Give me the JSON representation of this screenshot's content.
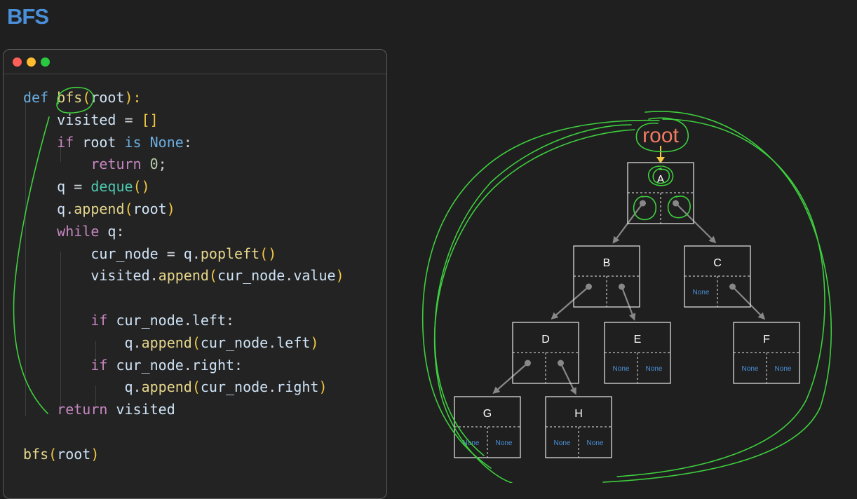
{
  "page": {
    "title": "BFS"
  },
  "code": {
    "lines": [
      [
        {
          "t": "def ",
          "c": "kw"
        },
        {
          "t": "bfs",
          "c": "fn"
        },
        {
          "t": "(",
          "c": "par"
        },
        {
          "t": "root",
          "c": "var"
        },
        {
          "t": "):",
          "c": "par"
        }
      ],
      [
        {
          "t": "    "
        },
        {
          "t": "visited",
          "c": "var"
        },
        {
          "t": " = "
        },
        {
          "t": "[]",
          "c": "par"
        }
      ],
      [
        {
          "t": "    "
        },
        {
          "t": "if ",
          "c": "kw2"
        },
        {
          "t": "root",
          "c": "var"
        },
        {
          "t": " is ",
          "c": "kw"
        },
        {
          "t": "None",
          "c": "kw"
        },
        {
          "t": ":"
        }
      ],
      [
        {
          "t": "        "
        },
        {
          "t": "return ",
          "c": "kw2"
        },
        {
          "t": "0",
          "c": "num"
        },
        {
          "t": ";"
        }
      ],
      [
        {
          "t": "    "
        },
        {
          "t": "q",
          "c": "var"
        },
        {
          "t": " = "
        },
        {
          "t": "deque",
          "c": "cls"
        },
        {
          "t": "()",
          "c": "par"
        }
      ],
      [
        {
          "t": "    "
        },
        {
          "t": "q",
          "c": "var"
        },
        {
          "t": "."
        },
        {
          "t": "append",
          "c": "fn"
        },
        {
          "t": "(",
          "c": "par"
        },
        {
          "t": "root",
          "c": "var"
        },
        {
          "t": ")",
          "c": "par"
        }
      ],
      [
        {
          "t": "    "
        },
        {
          "t": "while ",
          "c": "kw2"
        },
        {
          "t": "q",
          "c": "var"
        },
        {
          "t": ":"
        }
      ],
      [
        {
          "t": "        "
        },
        {
          "t": "cur_node",
          "c": "var"
        },
        {
          "t": " = "
        },
        {
          "t": "q",
          "c": "var"
        },
        {
          "t": "."
        },
        {
          "t": "popleft",
          "c": "fn"
        },
        {
          "t": "()",
          "c": "par"
        }
      ],
      [
        {
          "t": "        "
        },
        {
          "t": "visited",
          "c": "var"
        },
        {
          "t": "."
        },
        {
          "t": "append",
          "c": "fn"
        },
        {
          "t": "(",
          "c": "par"
        },
        {
          "t": "cur_node",
          "c": "var"
        },
        {
          "t": "."
        },
        {
          "t": "value",
          "c": "var"
        },
        {
          "t": ")",
          "c": "par"
        }
      ],
      [],
      [
        {
          "t": "        "
        },
        {
          "t": "if ",
          "c": "kw2"
        },
        {
          "t": "cur_node",
          "c": "var"
        },
        {
          "t": "."
        },
        {
          "t": "left",
          "c": "var"
        },
        {
          "t": ":"
        }
      ],
      [
        {
          "t": "            "
        },
        {
          "t": "q",
          "c": "var"
        },
        {
          "t": "."
        },
        {
          "t": "append",
          "c": "fn"
        },
        {
          "t": "(",
          "c": "par"
        },
        {
          "t": "cur_node",
          "c": "var"
        },
        {
          "t": "."
        },
        {
          "t": "left",
          "c": "var"
        },
        {
          "t": ")",
          "c": "par"
        }
      ],
      [
        {
          "t": "        "
        },
        {
          "t": "if ",
          "c": "kw2"
        },
        {
          "t": "cur_node",
          "c": "var"
        },
        {
          "t": "."
        },
        {
          "t": "right",
          "c": "var"
        },
        {
          "t": ":"
        }
      ],
      [
        {
          "t": "            "
        },
        {
          "t": "q",
          "c": "var"
        },
        {
          "t": "."
        },
        {
          "t": "append",
          "c": "fn"
        },
        {
          "t": "(",
          "c": "par"
        },
        {
          "t": "cur_node",
          "c": "var"
        },
        {
          "t": "."
        },
        {
          "t": "right",
          "c": "var"
        },
        {
          "t": ")",
          "c": "par"
        }
      ],
      [
        {
          "t": "    "
        },
        {
          "t": "return ",
          "c": "kw2"
        },
        {
          "t": "visited",
          "c": "var"
        }
      ],
      [],
      [
        {
          "t": "bfs",
          "c": "fn"
        },
        {
          "t": "(",
          "c": "par"
        },
        {
          "t": "root",
          "c": "var"
        },
        {
          "t": ")",
          "c": "par"
        }
      ]
    ]
  },
  "tree": {
    "root_label": "root",
    "nodes": {
      "A": {
        "label": "A",
        "left": "B",
        "right": "C"
      },
      "B": {
        "label": "B",
        "left": "D",
        "right": "E"
      },
      "C": {
        "label": "C",
        "left": "None",
        "right": "F"
      },
      "D": {
        "label": "D",
        "left": "G",
        "right": "H"
      },
      "E": {
        "label": "E",
        "left": "None",
        "right": "None"
      },
      "F": {
        "label": "F",
        "left": "None",
        "right": "None"
      },
      "G": {
        "label": "G",
        "left": "None",
        "right": "None"
      },
      "H": {
        "label": "H",
        "left": "None",
        "right": "None"
      }
    },
    "colors": {
      "annotation": "#3ecf3e",
      "root_text": "#f07a62",
      "root_arrow": "#f2c744",
      "none_text": "#4a90d9"
    }
  }
}
